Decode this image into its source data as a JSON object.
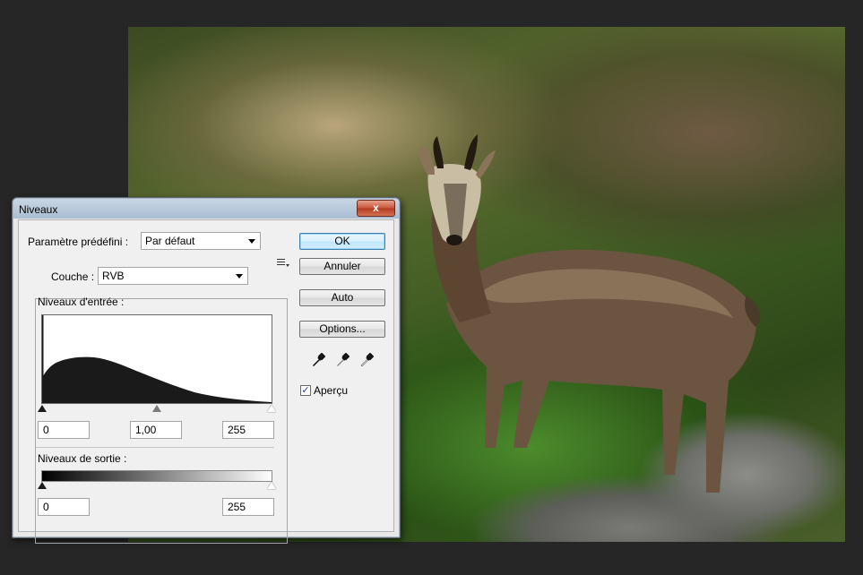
{
  "dialog": {
    "title": "Niveaux",
    "close_label": "x",
    "preset_label": "Paramètre prédéfini :",
    "preset_value": "Par défaut",
    "channel_label": "Couche :",
    "channel_value": "RVB",
    "input_levels_label": "Niveaux d'entrée :",
    "input_black": "0",
    "input_gamma": "1,00",
    "input_white": "255",
    "output_levels_label": "Niveaux de sortie :",
    "output_black": "0",
    "output_white": "255",
    "buttons": {
      "ok": "OK",
      "cancel": "Annuler",
      "auto": "Auto",
      "options": "Options..."
    },
    "preview_label": "Aperçu",
    "preview_checked": true,
    "check_mark": "✓"
  },
  "icons": [
    "eyedropper-black-icon",
    "eyedropper-gray-icon",
    "eyedropper-white-icon",
    "preset-menu-icon",
    "close-icon"
  ]
}
